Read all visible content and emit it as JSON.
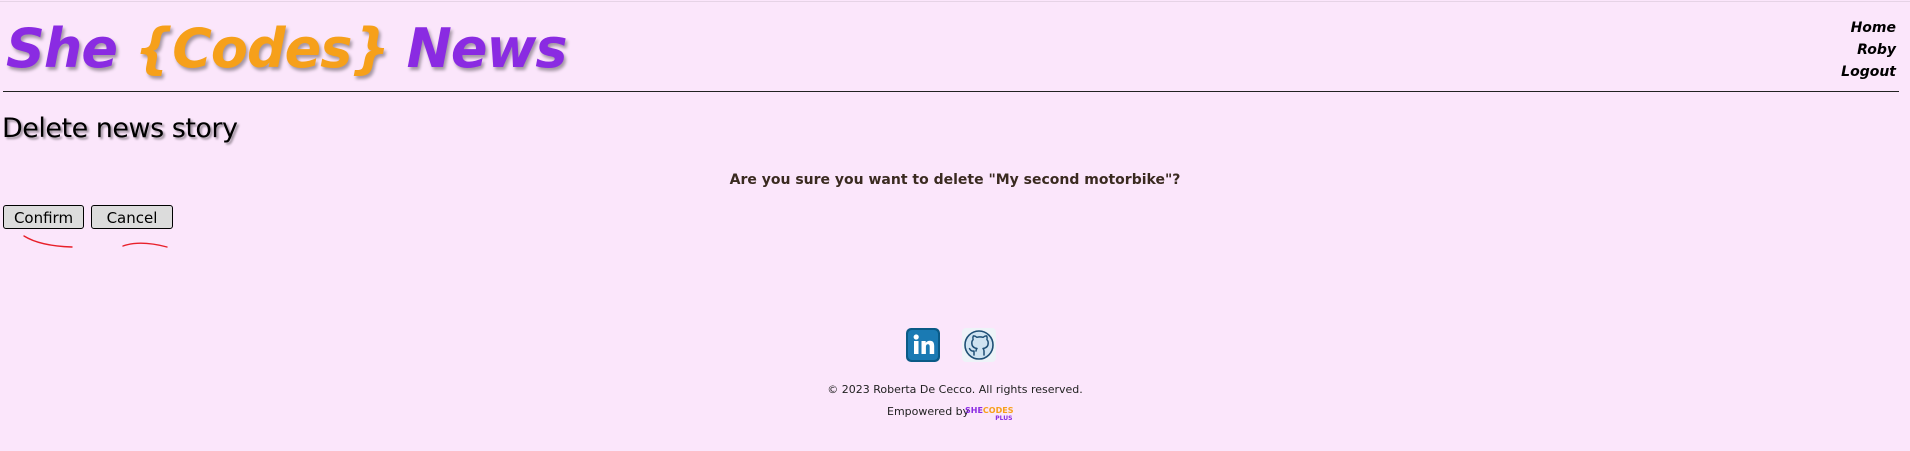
{
  "header": {
    "logo": {
      "she": "She",
      "codes": "{Codes}",
      "news": "News"
    },
    "nav": {
      "home": "Home",
      "user": "Roby",
      "logout": "Logout"
    }
  },
  "main": {
    "title": "Delete news story",
    "confirm_message": "Are you sure you want to delete \"My second motorbike\"?",
    "confirm_label": "Confirm",
    "cancel_label": "Cancel"
  },
  "footer": {
    "social_icons": [
      "linkedin-icon",
      "github-icon"
    ],
    "copyright": "© 2023 Roberta De Cecco. All rights reserved.",
    "empowered_by": "Empowered by",
    "sponsor_logo": {
      "she": "SHE",
      "codes": "CODES",
      "plus": "PLUS"
    }
  },
  "colors": {
    "background": "#fbe6fb",
    "brand_purple": "#8a2be2",
    "brand_orange": "#f6a01a",
    "annotation_red": "#e8202a"
  }
}
